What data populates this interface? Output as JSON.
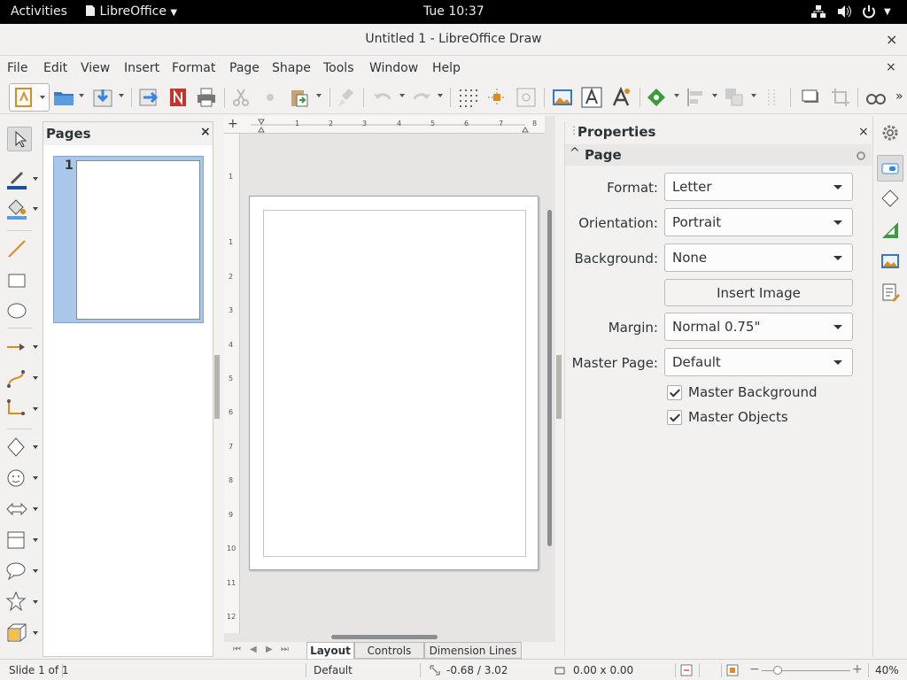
{
  "topbar": {
    "activities": "Activities",
    "app_menu": "LibreOffice",
    "clock": "Tue 10:37"
  },
  "window": {
    "title": "Untitled 1 - LibreOffice Draw",
    "close": "×"
  },
  "menu": {
    "items": [
      "File",
      "Edit",
      "View",
      "Insert",
      "Format",
      "Page",
      "Shape",
      "Tools",
      "Window",
      "Help"
    ],
    "close": "×"
  },
  "toolbar": {
    "overflow": "»"
  },
  "pages_panel": {
    "title": "Pages",
    "close": "×",
    "page_number": "1"
  },
  "canvas": {
    "hruler_marks": [
      "1",
      "1",
      "2",
      "3",
      "4",
      "5",
      "6",
      "7",
      "8"
    ],
    "vruler_marks": [
      "1",
      "1",
      "2",
      "3",
      "4",
      "5",
      "6",
      "7",
      "8",
      "9",
      "10",
      "11",
      "12"
    ]
  },
  "tabs": {
    "items": [
      "Layout",
      "Controls",
      "Dimension Lines"
    ],
    "active": "Layout"
  },
  "properties": {
    "title": "Properties",
    "close": "×",
    "section": "Page",
    "format_label": "Format:",
    "format_value": "Letter",
    "orientation_label": "Orientation:",
    "orientation_value": "Portrait",
    "background_label": "Background:",
    "background_value": "None",
    "insert_image": "Insert Image",
    "margin_label": "Margin:",
    "margin_value": "Normal 0.75\"",
    "master_page_label": "Master Page:",
    "master_page_value": "Default",
    "master_background": "Master Background",
    "master_objects": "Master Objects"
  },
  "status": {
    "slide": "Slide 1 of 1",
    "layout": "Default",
    "position": "-0.68 / 3.02",
    "size": "0.00 x 0.00",
    "zoom": "40%",
    "zoom_minus": "−",
    "zoom_plus": "+"
  },
  "colors": {
    "accent_blue": "#3584e4",
    "orange": "#e06c00",
    "selection": "#a9c7e8"
  }
}
